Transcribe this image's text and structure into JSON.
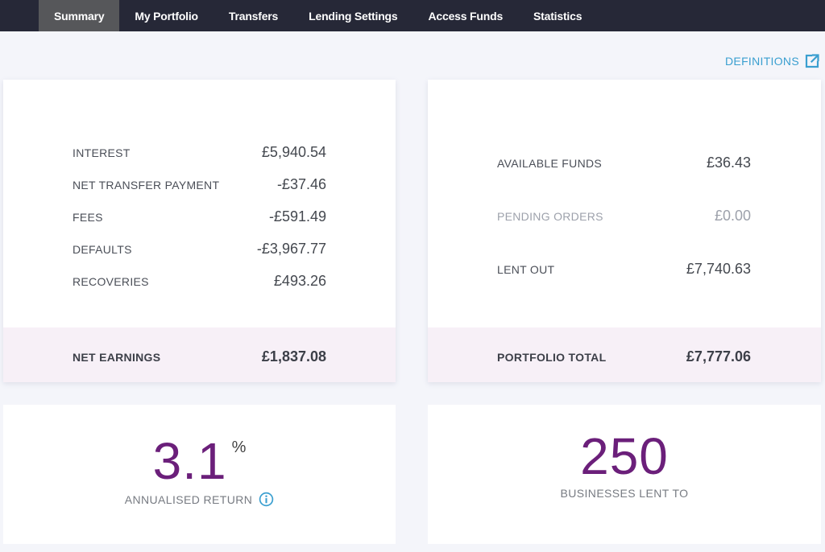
{
  "nav": {
    "items": [
      {
        "label": "Summary",
        "active": true
      },
      {
        "label": "My Portfolio",
        "active": false
      },
      {
        "label": "Transfers",
        "active": false
      },
      {
        "label": "Lending Settings",
        "active": false
      },
      {
        "label": "Access Funds",
        "active": false
      },
      {
        "label": "Statistics",
        "active": false
      }
    ]
  },
  "definitions": {
    "label": "DEFINITIONS",
    "icon": "external-link-icon"
  },
  "earnings": {
    "rows": [
      {
        "label": "INTEREST",
        "value": "£5,940.54"
      },
      {
        "label": "NET TRANSFER PAYMENT",
        "value": "-£37.46"
      },
      {
        "label": "FEES",
        "value": "-£591.49"
      },
      {
        "label": "DEFAULTS",
        "value": "-£3,967.77"
      },
      {
        "label": "RECOVERIES",
        "value": "£493.26"
      }
    ],
    "total": {
      "label": "NET EARNINGS",
      "value": "£1,837.08"
    }
  },
  "portfolio": {
    "rows": [
      {
        "label": "AVAILABLE FUNDS",
        "value": "£36.43"
      },
      {
        "label": "PENDING ORDERS",
        "value": "£0.00"
      },
      {
        "label": "LENT OUT",
        "value": "£7,740.63"
      }
    ],
    "total": {
      "label": "PORTFOLIO TOTAL",
      "value": "£7,777.06"
    }
  },
  "annualised_return": {
    "value": "3.1",
    "unit": "%",
    "label": "ANNUALISED RETURN",
    "icon": "info-icon"
  },
  "businesses": {
    "value": "250",
    "label": "BUSINESSES LENT TO"
  },
  "colors": {
    "nav_bg": "#262837",
    "nav_active": "#56575a",
    "accent_purple": "#6b1f7a",
    "link_blue": "#3a9fd0",
    "footer_bg": "#f7f0f7"
  }
}
